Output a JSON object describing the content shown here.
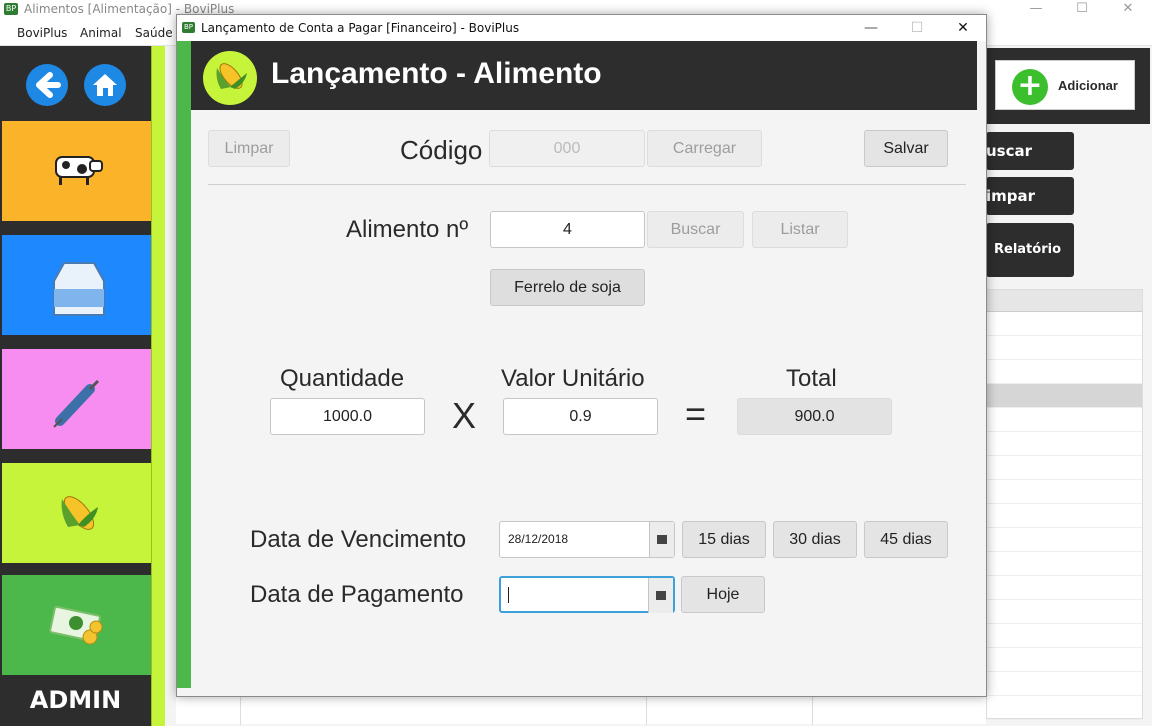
{
  "main_window": {
    "title": "Alimentos [Alimentação] - BoviPlus",
    "app_icon_text": "BP",
    "controls": {
      "minimize": "—",
      "maximize": "☐",
      "close": "✕"
    },
    "menu": [
      "BoviPlus",
      "Animal",
      "Saúde"
    ]
  },
  "sidebar": {
    "admin_label": "ADMIN",
    "tiles": [
      {
        "name": "cattle",
        "icon": "cow-icon",
        "color": "#fbb32a"
      },
      {
        "name": "milk",
        "icon": "milk-carton-icon",
        "color": "#1e88ff"
      },
      {
        "name": "health",
        "icon": "syringe-icon",
        "color": "#f78df0"
      },
      {
        "name": "food",
        "icon": "corn-icon",
        "color": "#c6f43a"
      },
      {
        "name": "finance",
        "icon": "money-icon",
        "color": "#4cb84c"
      }
    ]
  },
  "right_panel": {
    "add_label": "Adicionar",
    "search_label": "uscar",
    "clear_label": "impar",
    "report_label": "Relatório"
  },
  "dialog": {
    "title": "Lançamento de Conta a Pagar [Financeiro] - BoviPlus",
    "app_icon_text": "BP",
    "controls": {
      "minimize": "—",
      "maximize": "☐",
      "close": "✕"
    },
    "banner_title": "Lançamento - Alimento",
    "top_row": {
      "clear_label": "Limpar",
      "code_label": "Código",
      "code_value": "000",
      "load_label": "Carregar",
      "save_label": "Salvar"
    },
    "food": {
      "label": "Alimento nº",
      "value": "4",
      "search_label": "Buscar",
      "list_label": "Listar",
      "name": "Ferrelo de soja"
    },
    "calc": {
      "quantity_label": "Quantidade",
      "quantity_value": "1000.0",
      "times_symbol": "X",
      "unit_value_label": "Valor Unitário",
      "unit_value": "0.9",
      "equals_symbol": "=",
      "total_label": "Total",
      "total_value": "900.0"
    },
    "due": {
      "label": "Data de Vencimento",
      "value": "28/12/2018",
      "opt15": "15 dias",
      "opt30": "30 dias",
      "opt45": "45 dias"
    },
    "payment": {
      "label": "Data de Pagamento",
      "value": "",
      "today_label": "Hoje"
    }
  }
}
